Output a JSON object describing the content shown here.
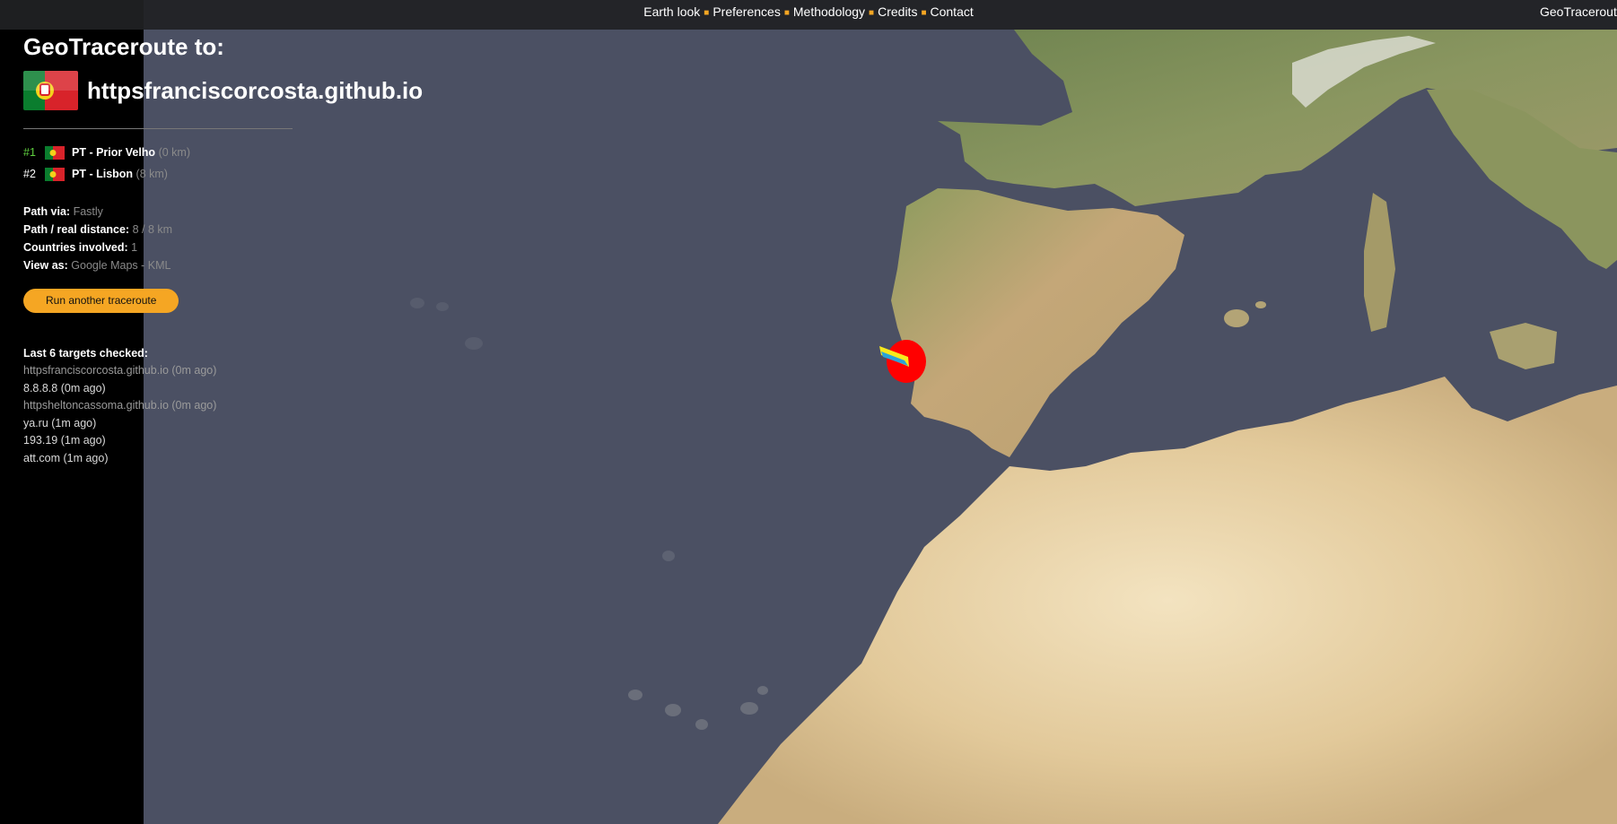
{
  "nav": {
    "items": [
      "Earth look",
      "Preferences",
      "Methodology",
      "Credits",
      "Contact"
    ],
    "brand": "GeoTraceroute"
  },
  "panel": {
    "heading": "GeoTraceroute to:",
    "target": "httpsfranciscorcosta.github.io",
    "target_flag": "portugal-flag",
    "hops": [
      {
        "num": "#1",
        "location": "PT - Prior Velho",
        "distance": "(0 km)"
      },
      {
        "num": "#2",
        "location": "PT - Lisbon",
        "distance": "(8 km)"
      }
    ],
    "path_via_label": "Path via:",
    "path_via_value": "Fastly",
    "distance_label": "Path / real distance:",
    "distance_value": "8 / 8 km",
    "countries_label": "Countries involved:",
    "countries_value": "1",
    "view_as_label": "View as:",
    "view_google": "Google Maps",
    "view_sep": "-",
    "view_kml": "KML",
    "run_button": "Run another traceroute",
    "last_title": "Last 6 targets checked:",
    "last_targets": [
      "httpsfranciscorcosta.github.io (0m ago)",
      "8.8.8.8 (0m ago)",
      "httpsheltoncassoma.github.io (0m ago)",
      "ya.ru (1m ago)",
      "193.19 (1m ago)",
      "att.com (1m ago)"
    ]
  },
  "map": {
    "ocean_color": "#4b5063",
    "land_color": "#c9ad7e",
    "marker_color": "#ff0000",
    "marker_icon": "traceroute-hop-marker"
  }
}
